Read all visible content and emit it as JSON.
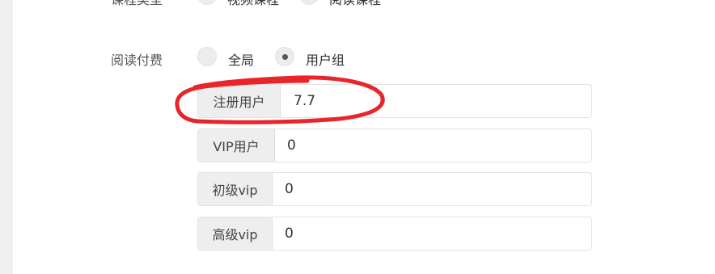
{
  "course_type": {
    "label": "课程类型",
    "options": [
      {
        "label": "视频课程"
      },
      {
        "label": "阅读课程"
      }
    ]
  },
  "reading_fee": {
    "label": "阅读付费",
    "options": [
      {
        "label": "全局",
        "checked": false
      },
      {
        "label": "用户组",
        "checked": true
      }
    ]
  },
  "prices": [
    {
      "group": "注册用户",
      "value": "7.7"
    },
    {
      "group": "VIP用户",
      "value": "0"
    },
    {
      "group": "初级vip",
      "value": "0"
    },
    {
      "group": "高级vip",
      "value": "0"
    }
  ],
  "annotation": {
    "color": "#e8252b",
    "shape": "hand-drawn-ellipse"
  }
}
